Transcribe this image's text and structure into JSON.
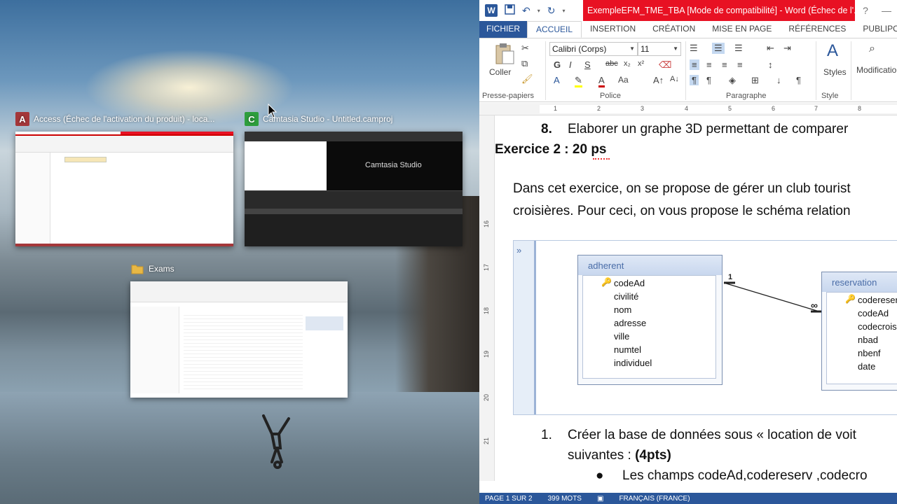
{
  "desktop": {
    "windows": [
      {
        "title": "Access (Échec de l'activation du produit) - loca...",
        "icon": "A"
      },
      {
        "title": "Camtasia Studio - Untitled.camproj",
        "icon": "C",
        "preview_text": "Camtasia Studio"
      },
      {
        "title": "Exams",
        "icon": "folder"
      }
    ]
  },
  "word": {
    "title": "ExempleEFM_TME_TBA [Mode de compatibilité] - Word (Échec de l'...",
    "controls": {
      "help": "?",
      "minimize": "—"
    },
    "tabs": [
      "FICHIER",
      "ACCUEIL",
      "INSERTION",
      "CRÉATION",
      "MISE EN PAGE",
      "RÉFÉRENCES",
      "PUBLIPOSTAG"
    ],
    "ribbon": {
      "paste_label": "Coller",
      "font_name": "Calibri (Corps)",
      "font_size": "11",
      "styles_label": "Styles",
      "modification_label": "Modification",
      "groups": [
        "Presse-papiers",
        "Police",
        "Paragraphe",
        "Style"
      ]
    },
    "ruler": [
      "1",
      "2",
      "3",
      "4",
      "5",
      "6",
      "7",
      "8"
    ],
    "vruler": [
      "16",
      "17",
      "18",
      "19",
      "20",
      "21"
    ],
    "doc": {
      "item8_num": "8.",
      "item8_text": "Elaborer un graphe 3D permettant de comparer",
      "exercise_title": "Exercice 2 : 20 ps",
      "para_line1": "Dans cet exercice, on se propose de gérer un club tourist",
      "para_line2": "croisières. Pour ceci, on vous propose le schéma relation",
      "item1_num": "1.",
      "item1_line1": "Créer la base de données sous « location de voit",
      "item1_line2_a": "suivantes : ",
      "item1_line2_b": "(4pts)",
      "bullet_text": "Les champs codeAd,codereserv ,codecro"
    },
    "diagram": {
      "tables": [
        {
          "name": "adherent",
          "key": "codeAd",
          "fields": [
            "civilité",
            "nom",
            "adresse",
            "ville",
            "numtel",
            "individuel"
          ]
        },
        {
          "name": "reservation",
          "key": "codereserv",
          "fields": [
            "codeAd",
            "codecrois",
            "nbad",
            "nbenf",
            "date"
          ]
        }
      ],
      "rel_one": "1",
      "rel_many": "∞"
    },
    "status": {
      "page": "PAGE 1 SUR 2",
      "words": "399 MOTS",
      "language": "FRANÇAIS (FRANCE)"
    }
  }
}
